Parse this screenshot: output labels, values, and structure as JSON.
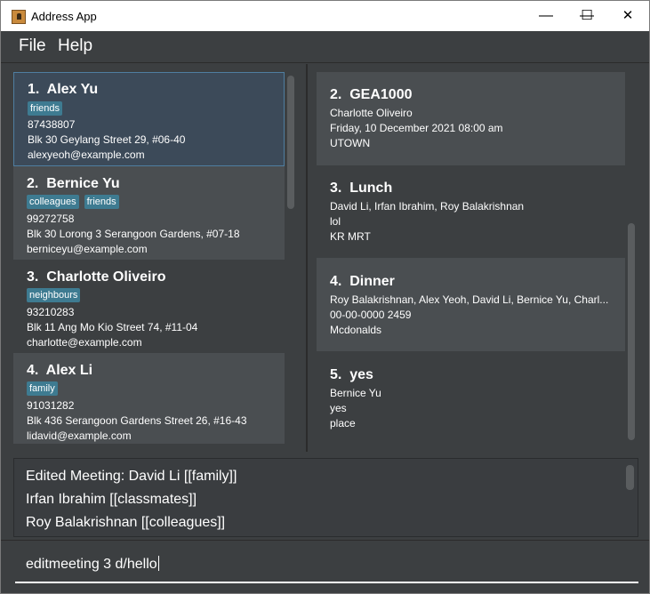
{
  "window": {
    "title": "Address App"
  },
  "window_controls": {
    "minimize": "—",
    "maximize": "☐",
    "close": "✕"
  },
  "menu": {
    "file": "File",
    "help": "Help"
  },
  "persons": [
    {
      "index": "1.",
      "name": "Alex Yu",
      "tags": [
        "friends"
      ],
      "phone": "87438807",
      "address": "Blk 30 Geylang Street 29, #06-40",
      "email": "alexyeoh@example.com",
      "selected": true
    },
    {
      "index": "2.",
      "name": "Bernice Yu",
      "tags": [
        "colleagues",
        "friends"
      ],
      "phone": "99272758",
      "address": "Blk 30 Lorong 3 Serangoon Gardens, #07-18",
      "email": "berniceyu@example.com",
      "selected": false
    },
    {
      "index": "3.",
      "name": "Charlotte Oliveiro",
      "tags": [
        "neighbours"
      ],
      "phone": "93210283",
      "address": "Blk 11 Ang Mo Kio Street 74, #11-04",
      "email": "charlotte@example.com",
      "selected": false
    },
    {
      "index": "4.",
      "name": "Alex Li",
      "tags": [
        "family"
      ],
      "phone": "91031282",
      "address": "Blk 436 Serangoon Gardens Street 26, #16-43",
      "email": "lidavid@example.com",
      "selected": false
    }
  ],
  "meetings": [
    {
      "index": "2.",
      "title": "GEA1000",
      "people": "Charlotte Oliveiro",
      "datetime": "Friday, 10 December 2021 08:00 am",
      "location": "UTOWN"
    },
    {
      "index": "3.",
      "title": "Lunch",
      "people": "David Li, Irfan Ibrahim, Roy Balakrishnan",
      "datetime": "lol",
      "location": "KR MRT"
    },
    {
      "index": "4.",
      "title": "Dinner",
      "people": "Roy Balakrishnan, Alex Yeoh, David Li, Bernice Yu, Charl...",
      "datetime": "00-00-0000 2459",
      "location": "Mcdonalds"
    },
    {
      "index": "5.",
      "title": "yes",
      "people": "Bernice Yu",
      "datetime": "yes",
      "location": "place"
    }
  ],
  "result": {
    "lines": [
      "Edited Meeting: David Li [[family]]",
      "Irfan Ibrahim [[classmates]]",
      "Roy Balakrishnan [[colleagues]]"
    ]
  },
  "command": {
    "value": "editmeeting 3 d/hello"
  },
  "colors": {
    "background": "#3c3f41",
    "card_dark": "#3c3f41",
    "card_light": "#4a4e51",
    "selected": "#3c4a59",
    "tag": "#3e7b91",
    "text": "#ffffff"
  }
}
